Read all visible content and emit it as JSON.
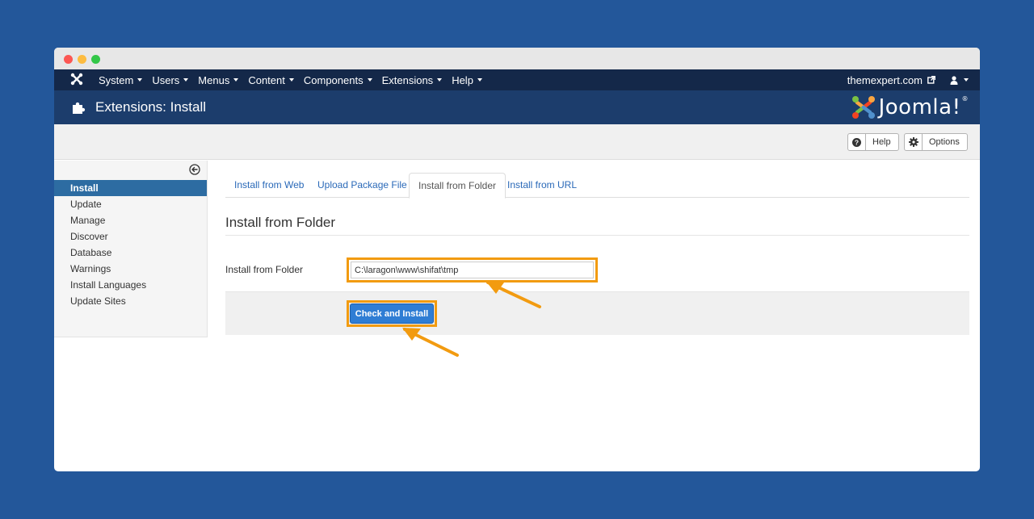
{
  "window": {
    "controls": [
      "close",
      "minimize",
      "maximize"
    ]
  },
  "navbar": {
    "logo_icon": "joomla-x-icon",
    "menu": [
      {
        "label": "System"
      },
      {
        "label": "Users"
      },
      {
        "label": "Menus"
      },
      {
        "label": "Content"
      },
      {
        "label": "Components"
      },
      {
        "label": "Extensions"
      },
      {
        "label": "Help"
      }
    ],
    "site_link": "themexpert.com",
    "user_icon": "user-icon"
  },
  "header": {
    "icon": "puzzle-icon",
    "title": "Extensions: Install",
    "brand": "Joomla!",
    "brand_mark": "®"
  },
  "toolbar": {
    "help_label": "Help",
    "options_label": "Options"
  },
  "sidebar": {
    "collapse_icon": "circle-arrow-left-icon",
    "items": [
      {
        "label": "Install",
        "active": true
      },
      {
        "label": "Update",
        "active": false
      },
      {
        "label": "Manage",
        "active": false
      },
      {
        "label": "Discover",
        "active": false
      },
      {
        "label": "Database",
        "active": false
      },
      {
        "label": "Warnings",
        "active": false
      },
      {
        "label": "Install Languages",
        "active": false
      },
      {
        "label": "Update Sites",
        "active": false
      }
    ]
  },
  "main": {
    "tabs": [
      {
        "label": "Install from Web",
        "active": false
      },
      {
        "label": "Upload Package File",
        "active": false
      },
      {
        "label": "Install from Folder",
        "active": true
      },
      {
        "label": "Install from URL",
        "active": false
      }
    ],
    "section_title": "Install from Folder",
    "folder_label": "Install from Folder",
    "folder_value": "C:\\laragon\\www\\shifat\\tmp",
    "install_button": "Check and Install"
  },
  "colors": {
    "page_bg": "#23579a",
    "navbar": "#142849",
    "header": "#1c3d6c",
    "accent": "#2d6ca2",
    "highlight": "#f29b10",
    "button": "#2f7dd4"
  }
}
